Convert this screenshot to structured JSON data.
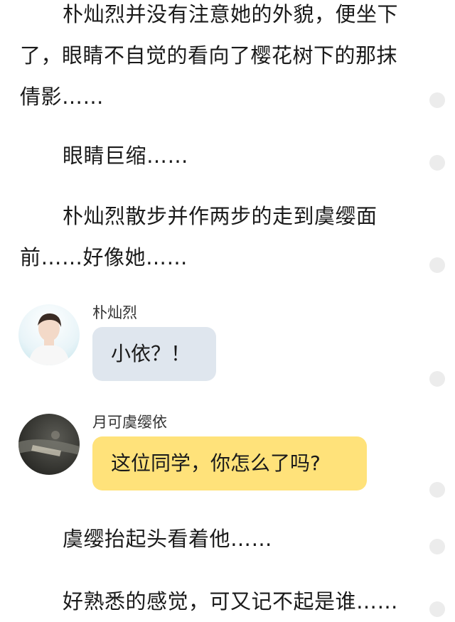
{
  "story": {
    "p1": "朴灿烈并没有注意她的外貌，便坐下了，眼睛不自觉的看向了樱花树下的那抹倩影……",
    "p2": "眼睛巨缩……",
    "p3": "朴灿烈散步并作两步的走到虞缨面前……好像她……",
    "p4": "虞缨抬起头看着他……",
    "p5": "好熟悉的感觉，可又记不起是谁……"
  },
  "chat": [
    {
      "speaker": "朴灿烈",
      "message": "小依？！",
      "bubble_color": "#dfe6ee"
    },
    {
      "speaker": "月可虞缨依",
      "message": "这位同学，你怎么了吗?",
      "bubble_color": "#ffe27a"
    }
  ]
}
